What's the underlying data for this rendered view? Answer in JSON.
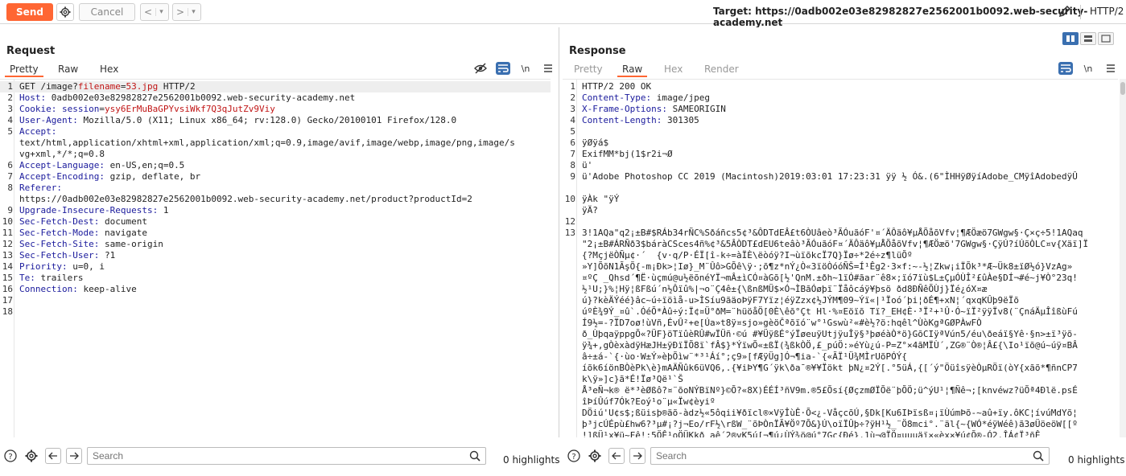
{
  "toolbar": {
    "send_label": "Send",
    "cancel_label": "Cancel",
    "back_label": "<",
    "back_dropdown": "▾",
    "forward_label": ">",
    "forward_dropdown": "▾",
    "target_label": "Target: https://0adb002e03e82982827e2562001b0092.web-security-academy.net",
    "protocol_label": "HTTP/2"
  },
  "request": {
    "title": "Request",
    "tabs": [
      "Pretty",
      "Raw",
      "Hex"
    ],
    "active_tab": "Pretty",
    "line_numbers": [
      "1",
      "2",
      "3",
      "4",
      "5",
      "6",
      "7",
      "8",
      "9",
      "10",
      "11",
      "12",
      "13",
      "14",
      "15",
      "16",
      "17",
      "18"
    ],
    "request_line": {
      "method": "GET /image?",
      "param": "filename",
      "eq": "=",
      "value": "53.jpg",
      "proto": " HTTP/2"
    },
    "headers": [
      {
        "key": "Host",
        "value": "0adb002e03e82982827e2562001b0092.web-security-academy.net"
      },
      {
        "key": "Cookie",
        "cookie_name": "session",
        "cookie_value": "ysy6ErMuBaGPYvsiWkf7Q3qJutZv9Viy"
      },
      {
        "key": "User-Agent",
        "value": "Mozilla/5.0 (X11; Linux x86_64; rv:128.0) Gecko/20100101 Firefox/128.0"
      },
      {
        "key": "Accept",
        "value": "",
        "cont1": "text/html,application/xhtml+xml,application/xml;q=0.9,image/avif,image/webp,image/png,image/s",
        "cont2": "vg+xml,*/*;q=0.8"
      },
      {
        "key": "Accept-Language",
        "value": "en-US,en;q=0.5"
      },
      {
        "key": "Accept-Encoding",
        "value": "gzip, deflate, br"
      },
      {
        "key": "Referer",
        "value": "",
        "cont1": "https://0adb002e03e82982827e2562001b0092.web-security-academy.net/product?productId=2"
      },
      {
        "key": "Upgrade-Insecure-Requests",
        "value": "1"
      },
      {
        "key": "Sec-Fetch-Dest",
        "value": "document"
      },
      {
        "key": "Sec-Fetch-Mode",
        "value": "navigate"
      },
      {
        "key": "Sec-Fetch-Site",
        "value": "same-origin"
      },
      {
        "key": "Sec-Fetch-User",
        "value": "?1"
      },
      {
        "key": "Priority",
        "value": "u=0, i"
      },
      {
        "key": "Te",
        "value": "trailers"
      },
      {
        "key": "Connection",
        "value": "keep-alive"
      }
    ]
  },
  "response": {
    "title": "Response",
    "tabs": [
      "Pretty",
      "Raw",
      "Hex",
      "Render"
    ],
    "active_tab": "Raw",
    "status_line": "HTTP/2 200 OK",
    "headers": [
      {
        "key": "Content-Type",
        "value": "image/jpeg"
      },
      {
        "key": "X-Frame-Options",
        "value": "SAMEORIGIN"
      },
      {
        "key": "Content-Length",
        "value": "301305"
      }
    ],
    "body_lines": {
      "l6": "ÿØÿá$",
      "l7": "ExifMM*bj(1$r2i¬Ø",
      "l8": "ü'",
      "l9": "ü'Adobe Photoshop CC 2019 (Macintosh)2019:03:01 17:23:31 ÿÿ ½ Ó&.(6\"ÌHHÿØÿíAdobe_CMÿîAdobedÿÛ",
      "l10": "ÿÀk \"ÿÝ",
      "l10b": "ÿÄ?",
      "l13": [
        "3!1AQa\"q2¡±B#$RÁb34rÑC%Sðáñcs5¢³&ÔDTdEÂ£t6ÒUâeò³ÃÓuãóF'¤´ÄÔäô¥µÅÕåõVfv¦¶ÆÖæö7GWgw§·Ç×ç÷5!1AQaq",
        "\"2¡±B#ÁRÑð3$báràCSces4ñ%¢³&5ÂÒDT£dEU6teâò³ÃÓuãóF¤´ÄÔäô¥µÅÕåõVfv¦¶ÆÖæö'7GWgw§·ÇÿÚ?íÚõÒLC¤v{Xäï]Ï",
        "{?MçjëÒÑµ¢·´  {v·q/P·ÉÏ[î-k÷=àÏÈ\\ëòóÿ?I¬ùïõkcÏ7Q}Ïø÷*2é÷z¶lüÕº",
        "»Y]ÕõN1ÃşÕ{-m¡Ðk>¦Iø}_M¨Ûô>GÕê\\ÿ·;õ¶z*nÝ¿Ò«3ïöÒóóÑŠ=Í¹Êg2·3×f:~-½¦Zkw¡iÏÕk³*Æ~Ük8±ïØ½ó}VzAg»",
        "¤ºÇ _Qhsd´¶Ë·ùçmú@u½ëõnéYÏ¬mÂ±ìCÓ¤àGõ[½'QnM.±ðh~1ïÓ#ãar¨ê8×;ïó7ïù$L±ÇµÓÙÎ²£ûÀe§DÍ¬#é~j¥Ò°23q!",
        "½¹U;}%¦Hÿ¦ßFßú´n½Ôïû%|¬o¨Ç4ê±{\\ßnßMÜ$×Ó¬ÌBãÓøþï¨Ïåôcáÿ¥þsö ðd8ÐÑêÕÙj}Ïé¿óX¤æ",
        "ú}?kèÄÝéé}âc~ú÷ïöìå-u>ÌSíu9ãäoÞÿF7Yïz¦éÿZzx¢½JÝM¶09~Ýï«|¹Ïoó´þi¦ðÉ¶+xN¦´qxqKÛþ9ëÏõ",
        "úºÈ¾9Ý_¤û`.ÓéÕ*Àû÷ý:Ï¢¤Ü°ðM=¨hüöåÖ[0È\\êõ°Çt Hl·%¤Eöïõ Tï?_EH¢È·³Ï²+¹Û·Ó~ïÏ²ÿÿÏv8(¨ÇnáÄµÎîßùFú",
        "Í9½=-?ÏD7oø!ùVñ,ÉvÛ²+e[Úa»t8ÿ¤sjo»gèöČªõïó¨w°¹Gswù²«#è½?ö:hqêl^ÙòKgªGØPÀwFÒ",
        "ð_ÙþqaÿppgÕ«?ÜF}öTïûèRÛ#wÏÜñ·©ú #¥ÜÿßÉ°ýÏøeuÿUtjÿuÎÿ§³þøéàÒ*ö}GõCIÿªVún5/éu\\ðeáï§Yê·§n>±ï³ÿõ-",
        "ÿ¾+,gÒèxàdÿHæJH±ÿÐïÏÕ8ï`fÂ$}*ÝïwÕ«±ßÏ(¾ßkÒÖ,£_púÖ:»éYù¿ú-P=Z°×4ãMÏÙ´,ZG®¨Ò®¦Â£{\\Io¹ïõ@ú~úÿ¤BÂ",
        "â÷±á-`{·ùo·W±Ý»èþÕìw¨*³¹Áí°;ç9»[fÆÿÜg]Ó¬¶ia-`{«ÃÏ¹Ü¾MÌrUõPÓÝ{",
        "íõk6íönBÒèPk\\è}mAÄÑûk6üVQ6,.{¥iÞY¶G´ÿk\\ða¯®¥¥Ïökt þN¿¤2Ý[.°5üÁ,{[´ý\"ÖüîsÿèÒµRÖï(òY{xãõ*¶ñnCP7",
        "k\\ÿ»]c}ã*É!Ïø³Që¹`Š",
        "Å³eÑ¬k® ë*³èØßô?¤¨õoNÝBïNº}©Õ?«8X)ÉÉÍ³ñV9m.®5£Õsí{ØçzmØÏÕë¨þÕÖ;ü^ýU¹¦¶Ñê¬;[knvéwz?üÕª4Ðlë.psÉ",
        "îÞíÛúf7Ók?Eoý¹o¨µ«Ïw¢èyiº",
        "DÖiú'U¢s$;ßüisþ®äõ-àdz½«5ôqii¥ðïcl®×VÿÎùÊ·Õ<¿-VåçcõÚ,§Dk[Ku6IÞïsß¤¡ïÙúmÞõ-~aû+ïy.ôKC¦ívúMdYõ¦",
        "þ³jcÚÉpù£hw6?³µ#¡?j¬Eo/rF½\\rßW_¨õÞÒnÏÃ¥Öº7Õ&}Ú\\oïÏÛþ÷?ÿH¹½_¨Ö8mci°.¨äl{~{WÓ*éÿWéê)ã3øÜöeöW[[º",
        "!]ßÜ¹x¥ü~Fê!:5ÖÊ¹oÖÜKkð¸aê´2®vK5ú[¬¶ú¿ÙÝ¾ö@ú°7Gç{Ðé}.1ù¬@ÏÖ¤uuuäï×«èx×¥ú¢Õ®-Ó2.ÎÁ¢Ï³ñÊ"
      ]
    }
  },
  "footer": {
    "search_placeholder": "Search",
    "left_highlights": "0 highlights",
    "right_highlights": "0 highlights"
  },
  "colors": {
    "accent": "#ff6633",
    "header_key": "#1a1a9c",
    "param_red": "#c01414",
    "toggle_blue": "#3a6fb0"
  }
}
